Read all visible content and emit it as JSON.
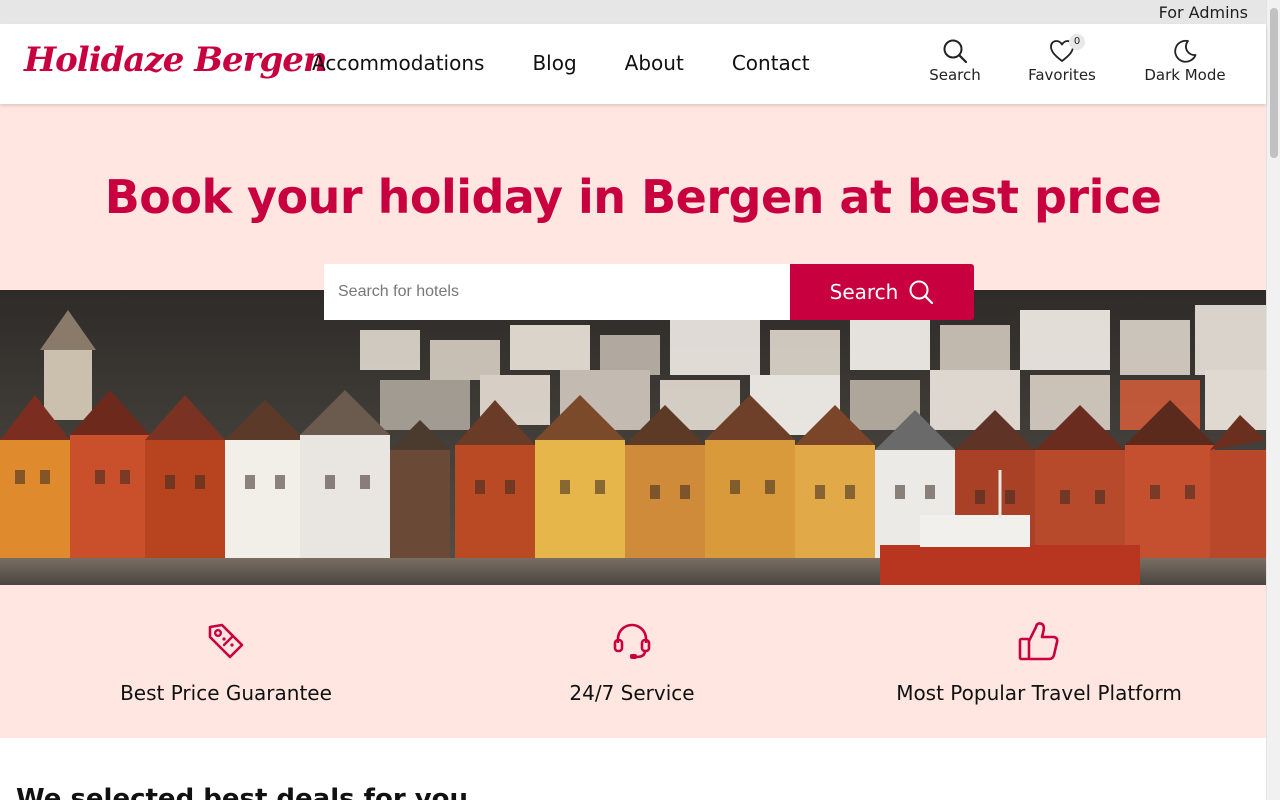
{
  "admin_bar": {
    "link": "For Admins"
  },
  "header": {
    "logo": "Holidaze Bergen",
    "nav": [
      "Accommodations",
      "Blog",
      "About",
      "Contact"
    ],
    "tools": {
      "search": {
        "label": "Search",
        "icon": "search-icon"
      },
      "favorites": {
        "label": "Favorites",
        "icon": "heart-icon",
        "count": "0"
      },
      "dark_mode": {
        "label": "Dark Mode",
        "icon": "moon-icon"
      }
    }
  },
  "hero": {
    "title": "Book your holiday in Bergen at best price",
    "search_placeholder": "Search for hotels",
    "search_value": "",
    "search_button": "Search",
    "image_icon": "bergen-harbour-photo"
  },
  "features": [
    {
      "label": "Best Price Guarantee",
      "icon": "price-tag-icon"
    },
    {
      "label": "24/7 Service",
      "icon": "headset-icon"
    },
    {
      "label": "Most Popular Travel Platform",
      "icon": "thumbs-up-icon"
    }
  ],
  "deals": {
    "title": "We selected best deals for you"
  },
  "colors": {
    "accent": "#c8003f",
    "hero_bg": "#ffe6e0",
    "admin_bar": "#e6e6e6"
  }
}
